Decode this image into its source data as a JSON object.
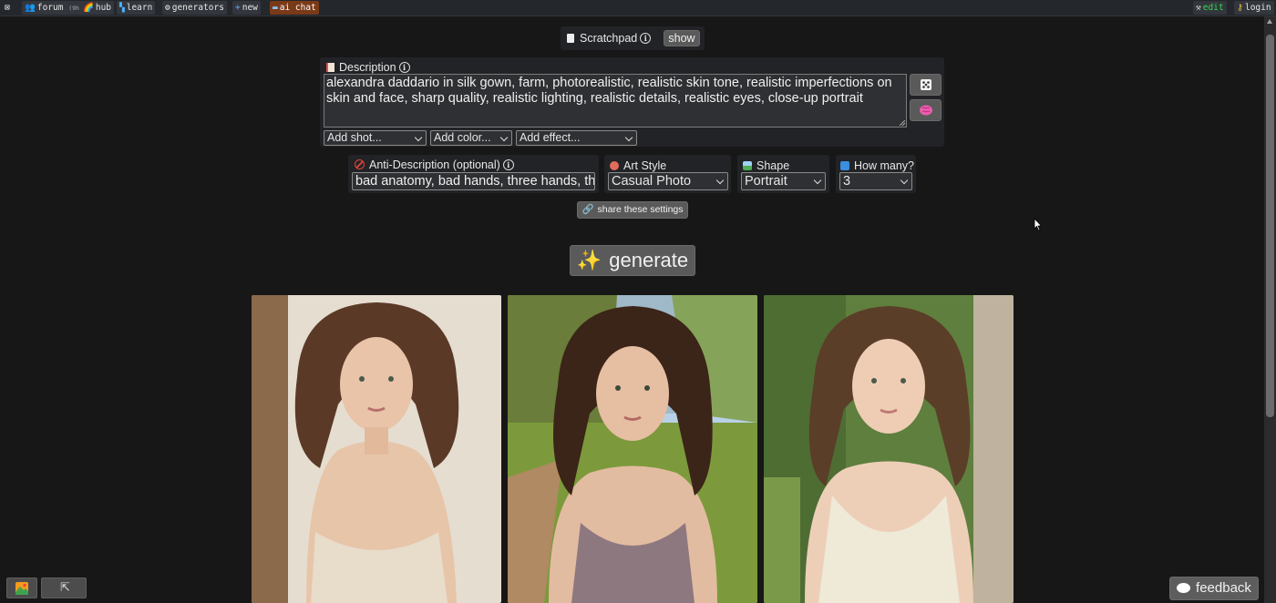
{
  "topbar": {
    "close_glyph": "⊠",
    "forum": "forum",
    "forum_count": "(9h)",
    "hub": "hub",
    "learn": "learn",
    "generators": "generators",
    "new": "new",
    "ai_chat": "ai chat",
    "edit": "edit",
    "login": "login"
  },
  "scratchpad": {
    "label": "Scratchpad",
    "show_button": "show"
  },
  "description": {
    "label": "Description",
    "value": "alexandra daddario in silk gown, farm, photorealistic, realistic skin tone, realistic imperfections on skin and face, sharp quality, realistic lighting, realistic details, realistic eyes, close-up portrait",
    "add_shot": "Add shot...",
    "add_color": "Add color...",
    "add_effect": "Add effect..."
  },
  "anti_description": {
    "label": "Anti-Description (optional)",
    "value": "bad anatomy, bad hands, three hands, three legs, bad arms"
  },
  "art_style": {
    "label": "Art Style",
    "value": "Casual Photo"
  },
  "shape": {
    "label": "Shape",
    "value": "Portrait"
  },
  "how_many": {
    "label": "How many?",
    "value": "3"
  },
  "share_button": "share these settings",
  "generate_button": "generate",
  "feedback_button": "feedback",
  "colors": {
    "background": "#171717",
    "panel": "#222326",
    "ai_chat": "#7a3a17",
    "edit": "#39d353"
  }
}
